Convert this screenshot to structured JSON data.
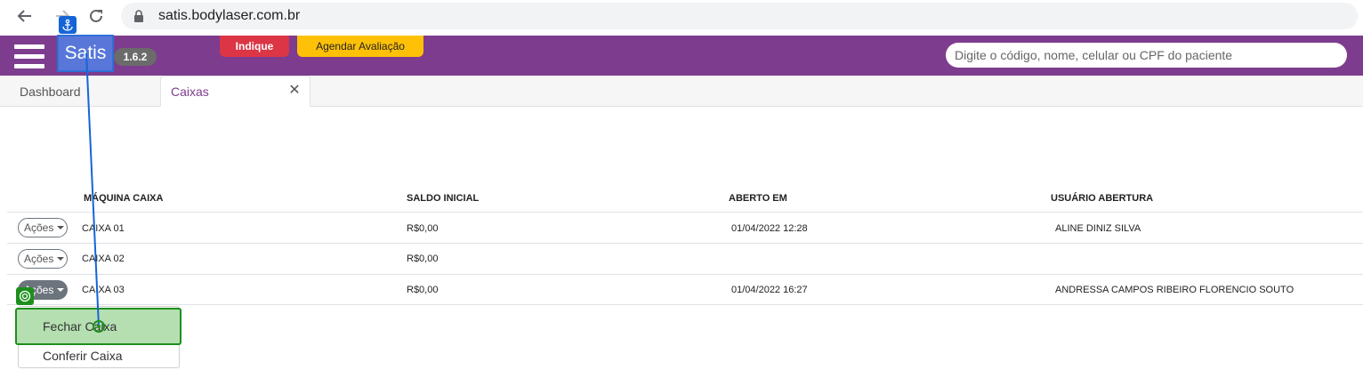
{
  "browser": {
    "url": "satis.bodylaser.com.br"
  },
  "header": {
    "brand": "Satis",
    "version": "1.6.2",
    "indique_label": "Indique",
    "agendar_label": "Agendar Avaliação",
    "search_placeholder": "Digite o código, nome, celular ou CPF do paciente",
    "color": "#7d3c8e"
  },
  "tabs": [
    {
      "label": "Dashboard"
    },
    {
      "label": "Caixas"
    }
  ],
  "table": {
    "columns": [
      "MÁQUINA CAIXA",
      "SALDO INICIAL",
      "ABERTO EM",
      "USUÁRIO ABERTURA"
    ],
    "rows": [
      {
        "acoes": "Ações",
        "maquina": "CAIXA 01",
        "saldo": "R$0,00",
        "aberto": "01/04/2022 12:28",
        "usuario": "ALINE DINIZ SILVA"
      },
      {
        "acoes": "Ações",
        "maquina": "CAIXA 02",
        "saldo": "R$0,00",
        "aberto": "",
        "usuario": ""
      },
      {
        "acoes": "Ações",
        "maquina": "CAIXA 03",
        "saldo": "R$0,00",
        "aberto": "01/04/2022 16:27",
        "usuario": "ANDRESSA CAMPOS RIBEIRO FLORENCIO SOUTO"
      }
    ]
  },
  "dropdown": {
    "items": [
      "Fechar Caixa",
      "Conferir Caixa"
    ]
  }
}
